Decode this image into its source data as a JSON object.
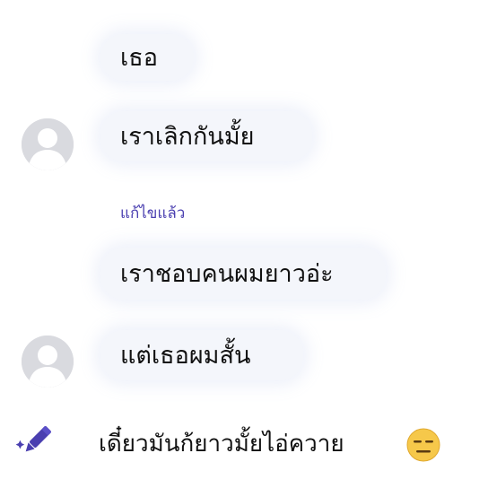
{
  "messages": [
    {
      "text": "เธอ"
    },
    {
      "text": "เราเลิกกันมั้ย"
    },
    {
      "edited_label": "แก้ไขแล้ว"
    },
    {
      "text": "เราชอบคนผมยาวอ่ะ"
    },
    {
      "text": "แต่เธอผมสั้น"
    }
  ],
  "composer": {
    "text": "เดี๋ยวมันก้ยาวมั้ยไอ่ควาย",
    "emoji": "expressionless-face"
  },
  "icons": {
    "edit": "pencil-sparkle-icon",
    "avatar": "default-user-avatar"
  },
  "colors": {
    "accent": "#4a3fb0",
    "bubble": "#f4f6fb",
    "avatar": "#d9dadf"
  }
}
